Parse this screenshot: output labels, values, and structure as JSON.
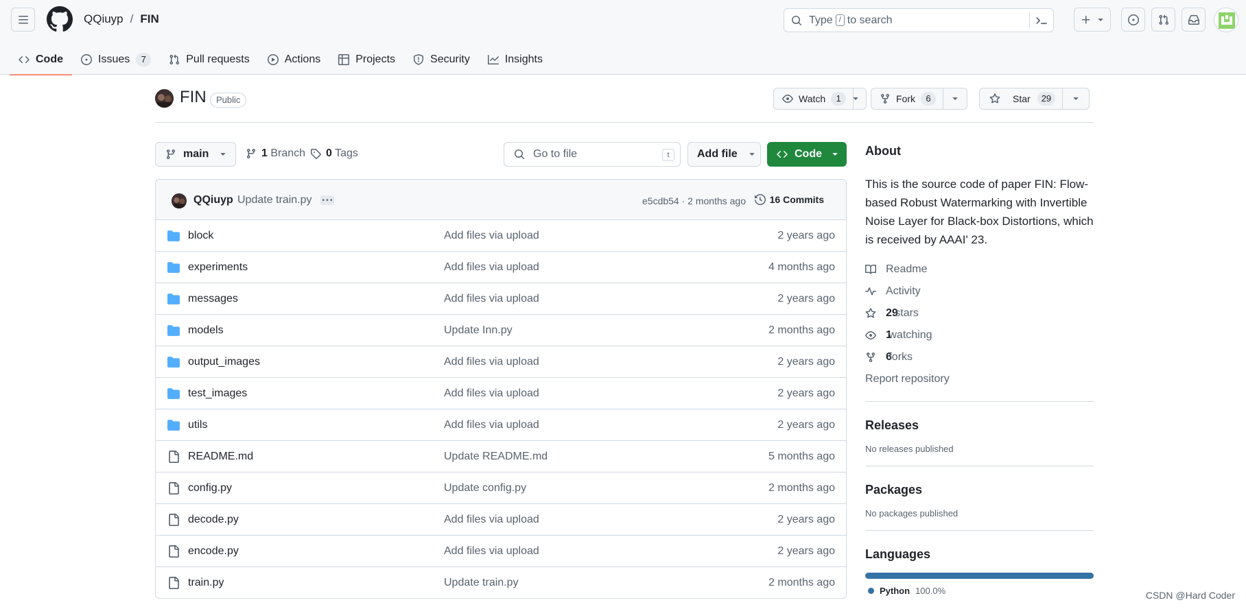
{
  "header": {
    "owner": "QQiuyp",
    "separator": "/",
    "repo": "FIN",
    "search": {
      "prefix": "Type",
      "key": "/",
      "suffix": "to search"
    }
  },
  "tabs": [
    {
      "label": "Code",
      "icon": "code-icon",
      "active": true
    },
    {
      "label": "Issues",
      "icon": "issue-opened-icon",
      "count": "7"
    },
    {
      "label": "Pull requests",
      "icon": "git-pull-request-icon"
    },
    {
      "label": "Actions",
      "icon": "play-icon"
    },
    {
      "label": "Projects",
      "icon": "table-icon"
    },
    {
      "label": "Security",
      "icon": "shield-icon"
    },
    {
      "label": "Insights",
      "icon": "graph-icon"
    }
  ],
  "repo": {
    "name": "FIN",
    "visibility": "Public",
    "watch": {
      "label": "Watch",
      "count": "1"
    },
    "fork": {
      "label": "Fork",
      "count": "6"
    },
    "star": {
      "label": "Star",
      "count": "29"
    }
  },
  "toolbar": {
    "branch": "main",
    "branches_count": "1",
    "branches_label": "Branch",
    "tags_count": "0",
    "tags_label": "Tags",
    "goto_placeholder": "Go to file",
    "goto_key": "t",
    "add_file": "Add file",
    "code": "Code"
  },
  "commit": {
    "author": "QQiuyp",
    "message": "Update train.py",
    "meta": "e5cdb54 · 2 months ago",
    "commits_label": "16 Commits"
  },
  "files": [
    {
      "name": "block",
      "type": "dir",
      "message": "Add files via upload",
      "date": "2 years ago"
    },
    {
      "name": "experiments",
      "type": "dir",
      "message": "Add files via upload",
      "date": "4 months ago"
    },
    {
      "name": "messages",
      "type": "dir",
      "message": "Add files via upload",
      "date": "2 years ago"
    },
    {
      "name": "models",
      "type": "dir",
      "message": "Update Inn.py",
      "date": "2 months ago"
    },
    {
      "name": "output_images",
      "type": "dir",
      "message": "Add files via upload",
      "date": "2 years ago"
    },
    {
      "name": "test_images",
      "type": "dir",
      "message": "Add files via upload",
      "date": "2 years ago"
    },
    {
      "name": "utils",
      "type": "dir",
      "message": "Add files via upload",
      "date": "2 years ago"
    },
    {
      "name": "README.md",
      "type": "file",
      "message": "Update README.md",
      "date": "5 months ago"
    },
    {
      "name": "config.py",
      "type": "file",
      "message": "Update config.py",
      "date": "2 months ago"
    },
    {
      "name": "decode.py",
      "type": "file",
      "message": "Add files via upload",
      "date": "2 years ago"
    },
    {
      "name": "encode.py",
      "type": "file",
      "message": "Add files via upload",
      "date": "2 years ago"
    },
    {
      "name": "train.py",
      "type": "file",
      "message": "Update train.py",
      "date": "2 months ago"
    }
  ],
  "about": {
    "title": "About",
    "description": "This is the source code of paper FIN: Flow-based Robust Watermarking with Invertible Noise Layer for Black-box Distortions, which is received by AAAI' 23.",
    "readme": "Readme",
    "activity": "Activity",
    "stars_count": "29",
    "stars_label": "stars",
    "watching_count": "1",
    "watching_label": "watching",
    "forks_count": "6",
    "forks_label": "forks",
    "report": "Report repository"
  },
  "releases": {
    "title": "Releases",
    "empty": "No releases published"
  },
  "packages": {
    "title": "Packages",
    "empty": "No packages published"
  },
  "languages": {
    "title": "Languages",
    "items": [
      {
        "name": "Python",
        "percent": "100.0%",
        "color": "#3572a5"
      }
    ]
  },
  "watermark": "CSDN @Hard Coder",
  "colors": {
    "accent_green": "#1f883d",
    "folder_blue": "#54aeff",
    "tab_underline": "#fd8c73"
  }
}
